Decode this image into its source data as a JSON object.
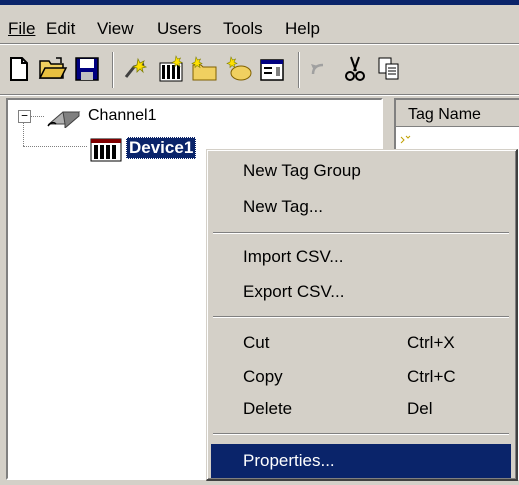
{
  "menubar": {
    "items": [
      {
        "label": "File"
      },
      {
        "label": "Edit"
      },
      {
        "label": "View"
      },
      {
        "label": "Users"
      },
      {
        "label": "Tools"
      },
      {
        "label": "Help"
      }
    ]
  },
  "toolbar": {
    "icons": [
      "new-file-icon",
      "open-folder-icon",
      "save-icon",
      "new-channel-icon",
      "new-device-icon",
      "new-tag-group-icon",
      "new-tag-icon",
      "properties-icon",
      "undo-icon",
      "cut-icon",
      "copy-icon"
    ]
  },
  "tree": {
    "channel": {
      "label": "Channel1",
      "expander": "−"
    },
    "device": {
      "label": "Device1"
    }
  },
  "list": {
    "column_header": "Tag Name"
  },
  "context_menu": {
    "items": [
      {
        "label": "New Tag Group",
        "shortcut": ""
      },
      {
        "label": "New Tag...",
        "shortcut": ""
      },
      {
        "label": "Import CSV...",
        "shortcut": ""
      },
      {
        "label": "Export CSV...",
        "shortcut": ""
      },
      {
        "label": "Cut",
        "shortcut": "Ctrl+X"
      },
      {
        "label": "Copy",
        "shortcut": "Ctrl+C"
      },
      {
        "label": "Delete",
        "shortcut": "Del"
      },
      {
        "label": "Properties...",
        "shortcut": ""
      }
    ],
    "selected": "Properties...",
    "colors": {
      "highlight": "#0a246a",
      "face": "#d4d0c8"
    }
  }
}
